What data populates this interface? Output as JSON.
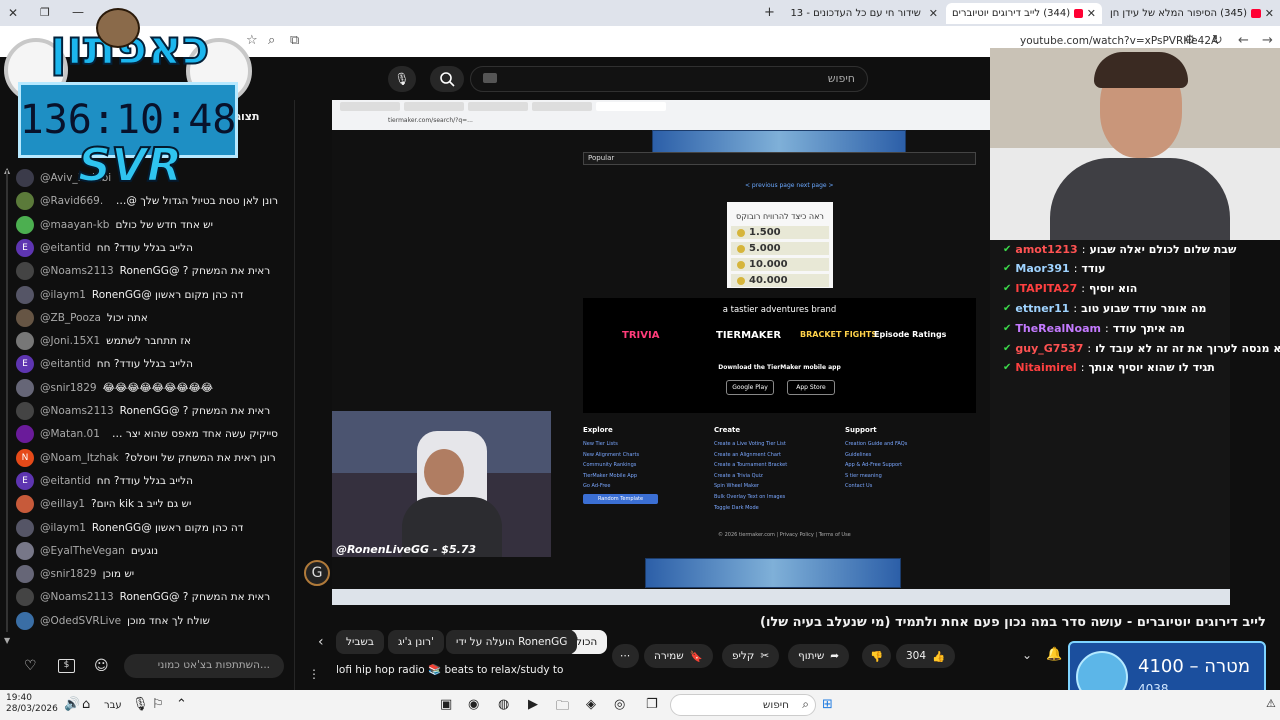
{
  "browser": {
    "tabs": [
      {
        "label": "(345) הסיפור המלא של עידן חן"
      },
      {
        "label": "(344) לייב דירוגים יוטיוברים"
      },
      {
        "label": "שידור חי עם כל העדכונים - 13"
      }
    ],
    "url": "youtube.com/watch?v=xPsPVRHe42A"
  },
  "youtube_header": {
    "search_placeholder": "חיפוש"
  },
  "overlay": {
    "logo_text": "כאפתון",
    "timer": "136:10:48",
    "brand": "SVR"
  },
  "chat": {
    "title": "תצוגה ב",
    "messages": [
      {
        "user": "@Aviv_Habibi",
        "text": "",
        "color": "#3b3b4a",
        "initial": ""
      },
      {
        "user": "@Ravid669.",
        "text": "רונן לאן טסת בטיול הגדול שלך @RonenGG",
        "color": "#5b7a3a",
        "initial": ""
      },
      {
        "user": "@maayan-kb",
        "text": "יש אחד חדש של כולם",
        "color": "#4caf50",
        "initial": ""
      },
      {
        "user": "@eitantid",
        "text": "הלייב בגלל עודד? חח",
        "color": "#5e35b1",
        "initial": "E"
      },
      {
        "user": "@Noams2113",
        "text": "ראית את המשחק ? @RonenGG",
        "color": "#444",
        "initial": ""
      },
      {
        "user": "@ilaym1",
        "text": "דה כהן מקום ראשון @RonenGG",
        "color": "#556",
        "initial": ""
      },
      {
        "user": "@ZB_Pooza",
        "text": "אתה יכול",
        "color": "#654",
        "initial": ""
      },
      {
        "user": "@Joni.15X1",
        "text": "אז תתחבר לשתמש",
        "color": "#777",
        "initial": ""
      },
      {
        "user": "@eitantid",
        "text": "הלייב בגלל עודד? חח",
        "color": "#5e35b1",
        "initial": "E"
      },
      {
        "user": "@snir1829",
        "text": "😂😂😂😂😂😂😂😂😂",
        "color": "#667",
        "initial": ""
      },
      {
        "user": "@Noams2113",
        "text": "ראית את המשחק ? @RonenGG",
        "color": "#444",
        "initial": ""
      },
      {
        "user": "@Matan.01",
        "text": "סייקיק עשה אחד מאפס שהוא יצר תשתמש בו",
        "color": "#6a1b9a",
        "initial": ""
      },
      {
        "user": "@Noam_Itzhak",
        "text": "רונן ראית את המשחק של ויוסלס?",
        "color": "#e64a19",
        "initial": "N"
      },
      {
        "user": "@eitantid",
        "text": "הלייב בגלל עודד? חח",
        "color": "#5e35b1",
        "initial": "E"
      },
      {
        "user": "@eillay1",
        "text": "יש גם לייב ב kik היום?",
        "color": "#c75a3a",
        "initial": ""
      },
      {
        "user": "@ilaym1",
        "text": "דה כהן מקום ראשון @RonenGG",
        "color": "#556",
        "initial": ""
      },
      {
        "user": "@EyalTheVegan",
        "text": "נוגעים",
        "color": "#778",
        "initial": ""
      },
      {
        "user": "@snir1829",
        "text": "יש מוכן",
        "color": "#667",
        "initial": ""
      },
      {
        "user": "@Noams2113",
        "text": "ראית את המשחק ? @RonenGG",
        "color": "#444",
        "initial": ""
      },
      {
        "user": "@OdedSVRLive",
        "text": "שולח לך אחד מוכן",
        "color": "#3a6ea5",
        "initial": ""
      }
    ],
    "input_placeholder": "השתתפות בצ'אט כמוני..."
  },
  "video": {
    "inner_url": "tiermaker.com/search/?q=...",
    "select_value": "Popular",
    "pager": "< previous page   next page >",
    "coins_title": "ראה כיצד להרוויח רובוקס",
    "coins": [
      "1.500",
      "5.000",
      "10.000",
      "40.000"
    ],
    "brand_heading": "a tastier adventures brand",
    "brands": [
      "TRIVIA",
      "TIERMAKER",
      "BRACKET FIGHTS",
      "Episode Ratings"
    ],
    "app_text": "Download the TierMaker mobile app",
    "store_buttons": [
      "Google Play",
      "App Store"
    ],
    "footer": [
      {
        "title": "Explore",
        "links": [
          "New Tier Lists",
          "New Alignment Charts",
          "Community Rankings",
          "TierMaker Mobile App",
          "Go Ad-Free"
        ]
      },
      {
        "title": "Create",
        "links": [
          "Create a Live Voting Tier List",
          "Create an Alignment Chart",
          "Create a Tournament Bracket",
          "Create a Trivia Quiz",
          "Spin Wheel Maker",
          "Bulk Overlay Text on Images",
          "Toggle Dark Mode"
        ]
      },
      {
        "title": "Support",
        "links": [
          "Creation Guide and FAQs",
          "Guidelines",
          "App & Ad-Free Support",
          "S tier meaning",
          "Contact Us"
        ]
      }
    ],
    "random_button": "Random Template",
    "copyright": "© 2026 tiermaker.com | Privacy Policy | Terms of Use",
    "donation": "@RonenLiveGG - $5.73",
    "overlay_chat": [
      {
        "name": "amot1213",
        "text": "שבת שלום לכולם יאלה שבוע",
        "color": "#ff5252"
      },
      {
        "name": "Maor391",
        "text": "עודד",
        "color": "#9fd3ff"
      },
      {
        "name": "ITAPITA27",
        "text": "הוא יוסיף",
        "color": "#ff4040"
      },
      {
        "name": "ettner11",
        "text": "מה אומר עודד שבוע טוב",
        "color": "#9fd3ff"
      },
      {
        "name": "TheRealNoam",
        "text": "מה איתך עודד",
        "color": "#c47aff"
      },
      {
        "name": "guy_G7537",
        "text": "לא מנסה לערוך את זה זה לא עובד לו",
        "color": "#ff5252"
      },
      {
        "name": "Nitaimirel",
        "text": "תגיד לו שהוא יוסיף אותך",
        "color": "#ff4040"
      }
    ]
  },
  "below_video": {
    "title": "לייב דירוגים יוטיוברים - עושה סדר במה נכון פעם אחת ולתמיד (מי שנעלב בעיה שלו)",
    "filter_chips": [
      "הכול",
      "הועלה על ידי RonenGG",
      "רונן ג'יג'",
      "בשביל"
    ],
    "actions": {
      "likes": "304",
      "share": "שיתוף",
      "clip": "קליפ",
      "save": "שמירה"
    },
    "related_title": "lofi hip hop radio 📚 beats to relax/study to",
    "goal_label": "מטרה – 4100",
    "goal_current": "4038"
  },
  "taskbar": {
    "time": "19:40",
    "date": "28/03/2026",
    "lang": "עבר",
    "search": "חיפוש"
  }
}
